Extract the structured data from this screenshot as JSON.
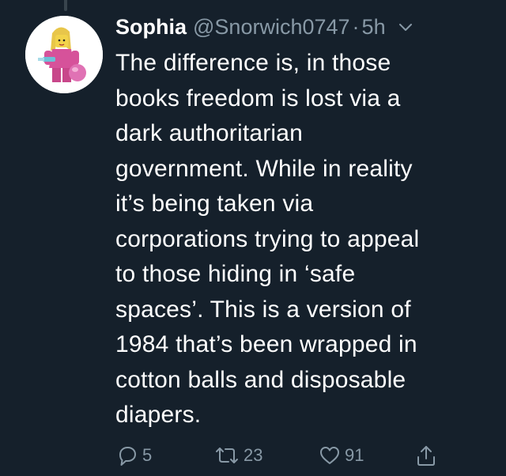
{
  "tweet": {
    "display_name": "Sophia",
    "handle": "@Snorwich0747",
    "separator": "·",
    "time": "5h",
    "text": "The difference is, in those\nbooks freedom is lost via a\ndark authoritarian\ngovernment. While in reality\nit’s being taken via\ncorporations trying to appeal\nto those hiding in ‘safe\nspaces’. This is a version of\n1984 that’s been wrapped in\ncotton balls and disposable\ndiapers."
  },
  "actions": {
    "reply_count": "5",
    "retweet_count": "23",
    "like_count": "91"
  },
  "icons": {
    "reply": "reply-icon",
    "retweet": "retweet-icon",
    "like": "heart-icon",
    "share": "share-icon",
    "menu": "chevron-down-icon"
  },
  "colors": {
    "background": "#15202b",
    "primary_text": "#ffffff",
    "secondary_text": "#8899a6",
    "thread_line": "#38444d"
  }
}
